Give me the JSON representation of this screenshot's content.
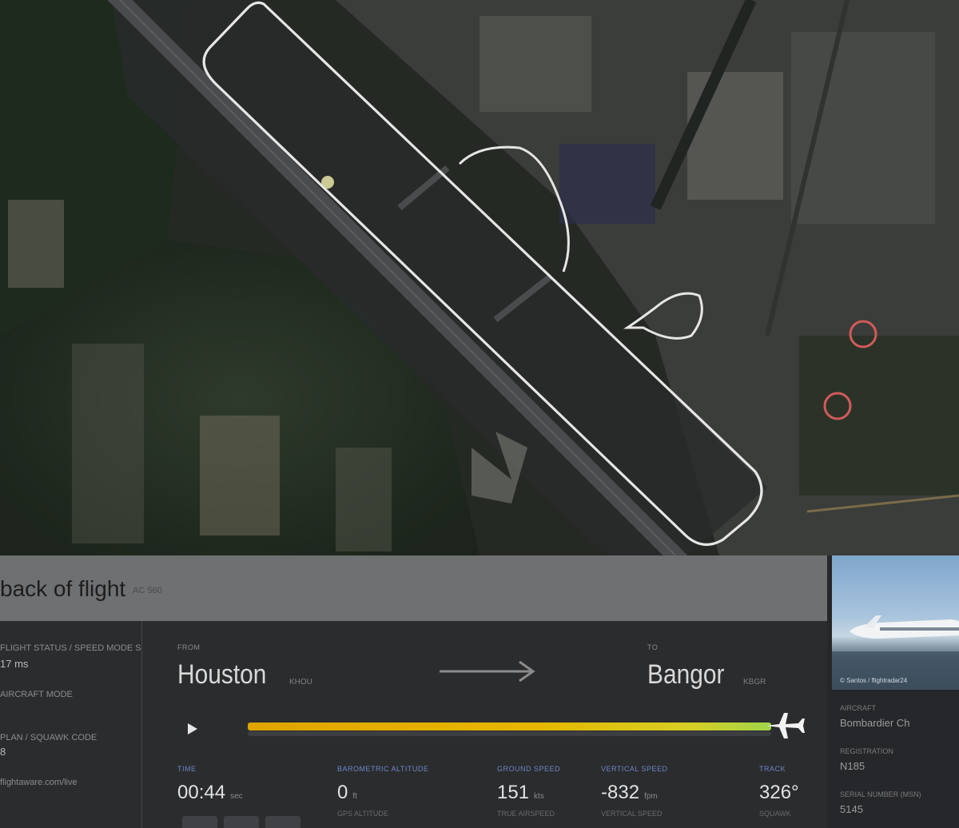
{
  "header": {
    "title": "back of flight",
    "subtitle": "AC 560"
  },
  "left_column": {
    "items": [
      {
        "label": "FLIGHT STATUS / SPEED MODE S",
        "value": "17 ms"
      },
      {
        "label": "AIRCRAFT MODE",
        "value": ""
      },
      {
        "label": "PLAN / SQUAWK CODE",
        "value": "8"
      },
      {
        "label": "flightaware.com/live",
        "value": ""
      }
    ]
  },
  "route": {
    "from_label": "FROM",
    "from_city": "Houston",
    "from_code": "KHOU",
    "to_label": "TO",
    "to_city": "Bangor",
    "to_code": "KBGR"
  },
  "playback": {
    "progress": 1.0,
    "play_icon": "play-icon",
    "plane_icon": "plane-icon"
  },
  "stats": {
    "time": {
      "label": "TIME",
      "value": "00:44",
      "unit": "sec",
      "sub": ""
    },
    "altitude": {
      "label": "BAROMETRIC ALTITUDE",
      "value": "0",
      "unit": "ft",
      "sub": "GPS ALTITUDE"
    },
    "speed": {
      "label": "GROUND SPEED",
      "value": "151",
      "unit": "kts",
      "sub": "TRUE AIRSPEED"
    },
    "vspeed": {
      "label": "VERTICAL SPEED",
      "value": "-832",
      "unit": "fpm",
      "sub": "VERTICAL SPEED"
    },
    "track": {
      "label": "TRACK",
      "value": "326°",
      "unit": "",
      "sub": "SQUAWK"
    }
  },
  "aircraft": {
    "photo_credit": "© Santos / flightradar24",
    "items": [
      {
        "label": "AIRCRAFT",
        "value": "Bombardier Ch"
      },
      {
        "label": "REGISTRATION",
        "value": "N185"
      },
      {
        "label": "SERIAL NUMBER (MSN)",
        "value": "5145"
      }
    ]
  },
  "colors": {
    "track_start": "#e0a400",
    "track_end": "#9fd44a",
    "accent_label": "#6d85c8"
  }
}
